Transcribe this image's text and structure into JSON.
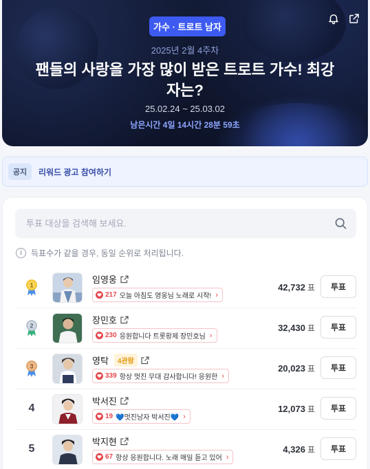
{
  "header": {
    "category": "가수 · 트로트 남자",
    "week": "2025년 2월 4주차",
    "title": "팬들의 사랑을 가장 많이 받은 트로트 가수! 최강자는?",
    "period": "25.02.24 ~ 25.03.02",
    "remaining": "남은시간 4일 14시간 28분 59초",
    "icons": [
      "bell-icon",
      "share-icon"
    ]
  },
  "notice": {
    "tag": "공지",
    "text": "리워드 광고 참여하기"
  },
  "search": {
    "placeholder": "투표 대상을 검색해 보세요."
  },
  "info_text": "득표수가 같을 경우, 동일 순위로 처리됩니다.",
  "ranking": [
    {
      "rank": "1",
      "name": "임영웅",
      "badge": "",
      "count": "217",
      "message": "오늘 아침도 영웅님 노래로 시작!",
      "votes": "42,732",
      "unit": "표",
      "vote_label": "투표",
      "medal_color": "#f2c230"
    },
    {
      "rank": "2",
      "name": "장민호",
      "badge": "",
      "count": "230",
      "message": "응원합니다 트롯황제 장민호님",
      "votes": "32,430",
      "unit": "표",
      "vote_label": "투표",
      "medal_color": "#b7c2cf"
    },
    {
      "rank": "3",
      "name": "영탁",
      "badge": "4관왕",
      "count": "339",
      "message": "항상 멋진 무대 감사합니다! 응원한",
      "votes": "20,023",
      "unit": "표",
      "vote_label": "투표",
      "medal_color": "#e0a36a"
    },
    {
      "rank": "4",
      "name": "박서진",
      "badge": "",
      "count": "19",
      "message": "💙멋진남자 박서진💙",
      "votes": "12,073",
      "unit": "표",
      "vote_label": "투표",
      "medal_color": ""
    },
    {
      "rank": "5",
      "name": "박지현",
      "badge": "",
      "count": "67",
      "message": "항상 응원합니다. 노래 매일 듣고 있어",
      "votes": "4,326",
      "unit": "표",
      "vote_label": "투표",
      "medal_color": ""
    }
  ],
  "colors": {
    "accent": "#3d5af1",
    "heart": "#e5484d",
    "gold_badge": "#e29a13"
  }
}
